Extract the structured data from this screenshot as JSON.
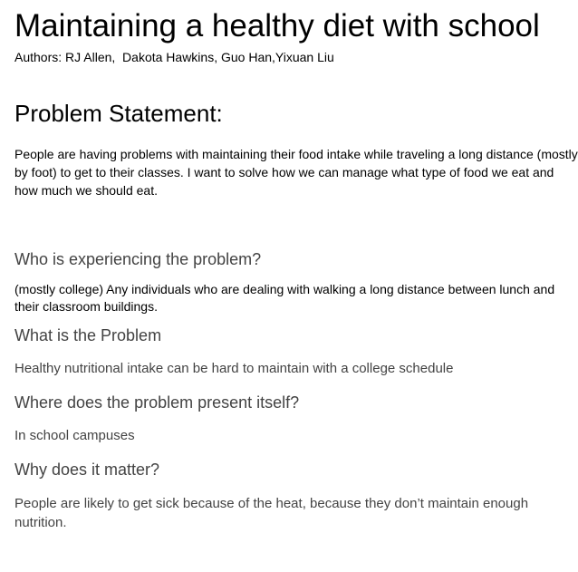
{
  "document": {
    "title": "Maintaining a healthy diet with school",
    "authors": "Authors: RJ Allen,  Dakota Hawkins, Guo Han,Yixuan Liu",
    "problem_statement": {
      "heading": "Problem Statement:",
      "text": "People are having problems with maintaining their food intake while traveling a long distance (mostly by foot) to get to their classes. I want to solve how we can manage what type of food we eat and how much we should eat."
    },
    "questions": [
      {
        "question": "Who is experiencing the problem?",
        "answer": "(mostly college) Any individuals who are dealing with walking a long distance between lunch and their classroom buildings."
      },
      {
        "question": "What is the Problem",
        "answer": "Healthy nutritional intake can be hard to maintain with a college schedule"
      },
      {
        "question": "Where does the problem present itself?",
        "answer": "In school campuses"
      },
      {
        "question": "Why does it matter?",
        "answer": "People are likely to get sick because of the heat, because they don’t maintain enough nutrition."
      }
    ]
  }
}
